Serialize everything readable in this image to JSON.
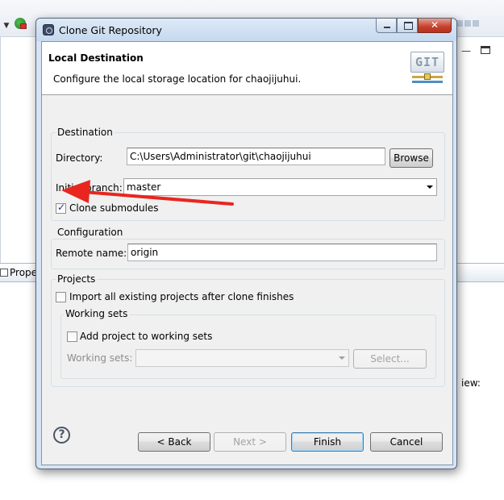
{
  "background": {
    "properties_tab_label": "Prope",
    "view_text": "iew:"
  },
  "dialog": {
    "title": "Clone Git Repository",
    "window_buttons": {
      "close_glyph": "✕"
    },
    "banner": {
      "title": "Local Destination",
      "description": "Configure the local storage location for chaojijuhui.",
      "logo_text": "GIT"
    },
    "destination": {
      "group_label": "Destination",
      "directory_label": "Directory:",
      "directory_value": "C:\\Users\\Administrator\\git\\chaojijuhui",
      "browse_label": "Browse",
      "initial_branch_label": "Initial branch:",
      "initial_branch_value": "master",
      "clone_submodules_label": "Clone submodules",
      "clone_submodules_checked": true
    },
    "configuration": {
      "group_label": "Configuration",
      "remote_name_label": "Remote name:",
      "remote_name_value": "origin"
    },
    "projects": {
      "group_label": "Projects",
      "import_label": "Import all existing projects after clone finishes",
      "import_checked": false,
      "working_sets": {
        "group_label": "Working sets",
        "add_label": "Add project to working sets",
        "add_checked": false,
        "working_sets_label": "Working sets:",
        "working_sets_value": "",
        "select_label": "Select..."
      }
    },
    "footer": {
      "help_glyph": "?",
      "back_label": "< Back",
      "next_label": "Next >",
      "finish_label": "Finish",
      "cancel_label": "Cancel"
    }
  },
  "annotation": {
    "arrow_color": "#e8261f"
  }
}
